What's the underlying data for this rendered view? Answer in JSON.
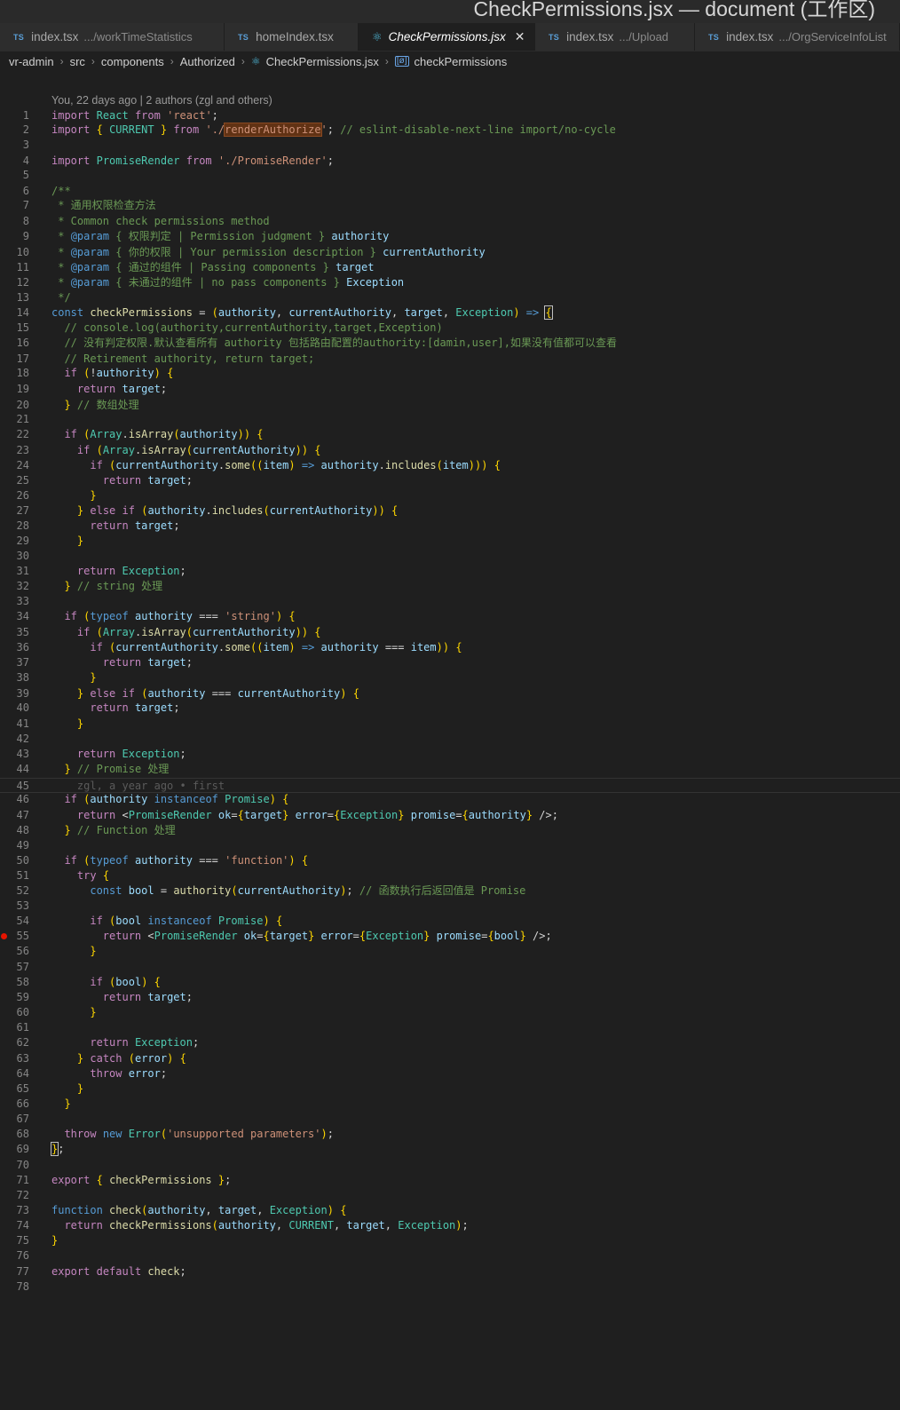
{
  "window": {
    "title": "CheckPermissions.jsx — document (工作区)"
  },
  "tabs": [
    {
      "icon": "TS",
      "name": "index.tsx",
      "path": ".../workTimeStatistics",
      "active": false
    },
    {
      "icon": "TS",
      "name": "homeIndex.tsx",
      "path": "",
      "active": false
    },
    {
      "icon": "react",
      "name": "CheckPermissions.jsx",
      "path": "",
      "active": true,
      "close": "✕"
    },
    {
      "icon": "TS",
      "name": "index.tsx",
      "path": ".../Upload",
      "active": false
    },
    {
      "icon": "TS",
      "name": "index.tsx",
      "path": ".../OrgServiceInfoList",
      "active": false
    }
  ],
  "breadcrumb": {
    "items": [
      "vr-admin",
      "src",
      "components",
      "Authorized",
      "CheckPermissions.jsx",
      "checkPermissions"
    ],
    "separator": "›"
  },
  "editor": {
    "codelens": "You, 22 days ago | 2 authors (zgl and others)",
    "blame_line_45": "zgl, a year ago • first",
    "breakpoint_line": 55,
    "line_numbers": [
      "1",
      "2",
      "3",
      "4",
      "5",
      "6",
      "7",
      "8",
      "9",
      "10",
      "11",
      "12",
      "13",
      "14",
      "15",
      "16",
      "17",
      "18",
      "19",
      "20",
      "21",
      "22",
      "23",
      "24",
      "25",
      "26",
      "27",
      "28",
      "29",
      "30",
      "31",
      "32",
      "33",
      "34",
      "35",
      "36",
      "37",
      "38",
      "39",
      "40",
      "41",
      "42",
      "43",
      "44",
      "45",
      "46",
      "47",
      "48",
      "49",
      "50",
      "51",
      "52",
      "53",
      "54",
      "55",
      "56",
      "57",
      "58",
      "59",
      "60",
      "61",
      "62",
      "63",
      "64",
      "65",
      "66",
      "67",
      "68",
      "69",
      "70",
      "71",
      "72",
      "73",
      "74",
      "75",
      "76",
      "77",
      "78"
    ],
    "lines": [
      "import React from 'react';",
      "import { CURRENT } from './renderAuthorize'; // eslint-disable-next-line import/no-cycle",
      "",
      "import PromiseRender from './PromiseRender';",
      "",
      "/**",
      " * 通用权限检查方法",
      " * Common check permissions method",
      " * @param { 权限判定 | Permission judgment } authority",
      " * @param { 你的权限 | Your permission description } currentAuthority",
      " * @param { 通过的组件 | Passing components } target",
      " * @param { 未通过的组件 | no pass components } Exception",
      " */",
      "const checkPermissions = (authority, currentAuthority, target, Exception) => {",
      "  // console.log(authority,currentAuthority,target,Exception)",
      "  // 没有判定权限.默认查看所有 authority 包括路由配置的authority:[damin,user],如果没有值都可以查看",
      "  // Retirement authority, return target;",
      "  if (!authority) {",
      "    return target;",
      "  } // 数组处理",
      "",
      "  if (Array.isArray(authority)) {",
      "    if (Array.isArray(currentAuthority)) {",
      "      if (currentAuthority.some((item) => authority.includes(item))) {",
      "        return target;",
      "      }",
      "    } else if (authority.includes(currentAuthority)) {",
      "      return target;",
      "    }",
      "",
      "    return Exception;",
      "  } // string 处理",
      "",
      "  if (typeof authority === 'string') {",
      "    if (Array.isArray(currentAuthority)) {",
      "      if (currentAuthority.some((item) => authority === item)) {",
      "        return target;",
      "      }",
      "    } else if (authority === currentAuthority) {",
      "      return target;",
      "    }",
      "",
      "    return Exception;",
      "  } // Promise 处理",
      "",
      "  if (authority instanceof Promise) {",
      "    return <PromiseRender ok={target} error={Exception} promise={authority} />;",
      "  } // Function 处理",
      "",
      "  if (typeof authority === 'function') {",
      "    try {",
      "      const bool = authority(currentAuthority); // 函数执行后返回值是 Promise",
      "",
      "      if (bool instanceof Promise) {",
      "        return <PromiseRender ok={target} error={Exception} promise={bool} />;",
      "      }",
      "",
      "      if (bool) {",
      "        return target;",
      "      }",
      "",
      "      return Exception;",
      "    } catch (error) {",
      "      throw error;",
      "    }",
      "  }",
      "",
      "  throw new Error('unsupported parameters');",
      "};",
      "",
      "export { checkPermissions };",
      "",
      "function check(authority, target, Exception) {",
      "  return checkPermissions(authority, CURRENT, target, Exception);",
      "}",
      "",
      "export default check;",
      ""
    ]
  }
}
